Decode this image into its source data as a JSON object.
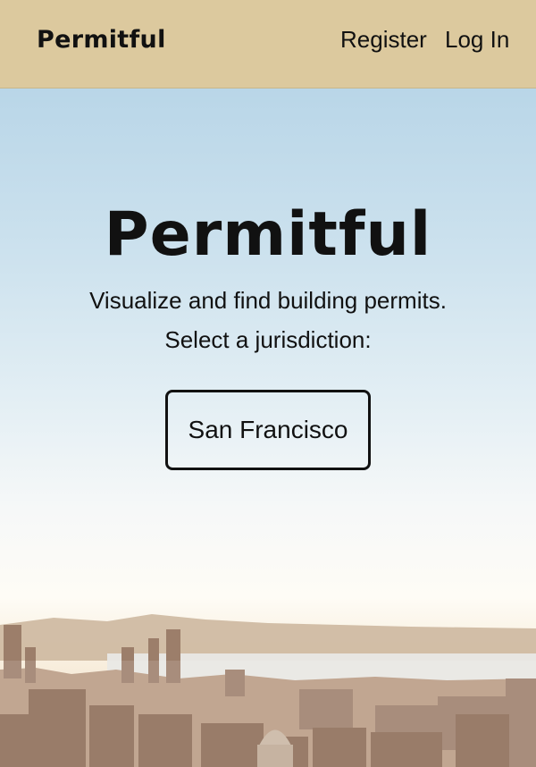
{
  "navbar": {
    "brand": "Permitful",
    "links": {
      "register": "Register",
      "login": "Log In"
    }
  },
  "hero": {
    "title": "Permitful",
    "subtitle": "Visualize and find building permits.",
    "prompt": "Select a jurisdiction:",
    "jurisdiction_button": "San Francisco",
    "background_image": "san-francisco-skyline"
  },
  "colors": {
    "navbar_bg": "#dcc99e",
    "text": "#111111"
  }
}
